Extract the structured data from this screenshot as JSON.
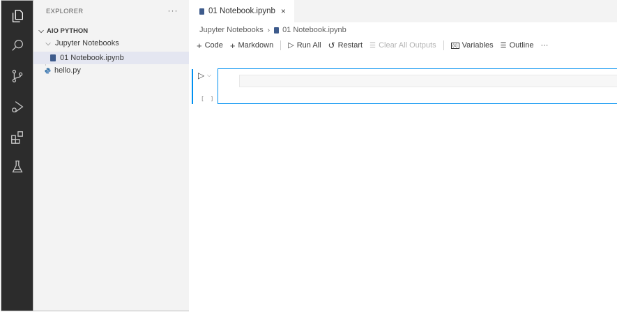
{
  "activity_bar": {
    "icons": [
      "explorer-icon",
      "search-icon",
      "source-control-icon",
      "run-debug-icon",
      "extensions-icon",
      "testing-icon"
    ]
  },
  "sidebar": {
    "header": "EXPLORER",
    "more": "···",
    "workspace": "AIO PYTHON",
    "folder": "Jupyter Notebooks",
    "notebook_file": "01 Notebook.ipynb",
    "python_file": "hello.py"
  },
  "editor": {
    "tab_label": "01 Notebook.ipynb",
    "tab_close": "×",
    "breadcrumb": [
      "Jupyter Notebooks",
      "01 Notebook.ipynb"
    ],
    "breadcrumb_sep": "›",
    "toolbar": {
      "code": "Code",
      "markdown": "Markdown",
      "run_all": "Run All",
      "restart": "Restart",
      "clear_outputs": "Clear All Outputs",
      "variables": "Variables",
      "outline": "Outline",
      "more": "···"
    },
    "cell": {
      "exec_count": "[ ]"
    }
  },
  "colors": {
    "accent": "#0090f1",
    "activity_bg": "#2c2c2c",
    "sidebar_bg": "#f3f3f3",
    "selected_row": "#e4e6f1"
  }
}
